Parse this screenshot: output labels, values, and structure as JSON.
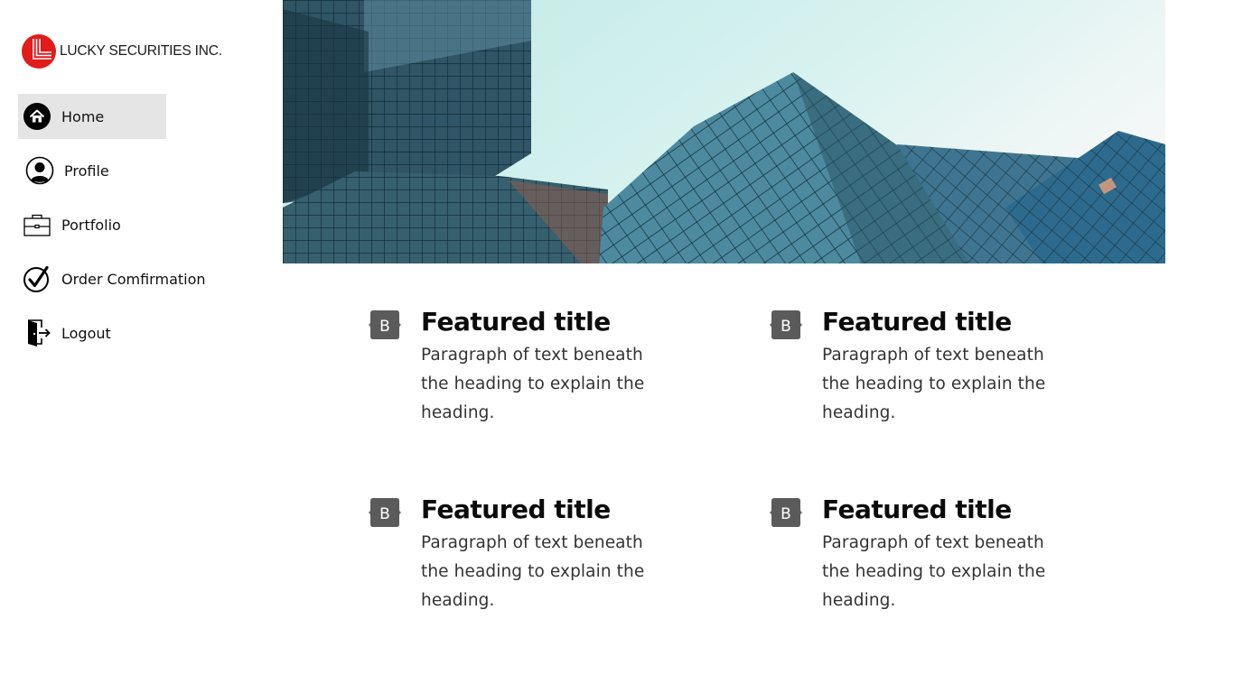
{
  "brand": {
    "name": "LUCKY SECURITIES INC.",
    "logo_color": "#e21b1b"
  },
  "sidebar": {
    "items": [
      {
        "label": "Home",
        "icon": "home-icon",
        "active": true
      },
      {
        "label": "Profile",
        "icon": "user-icon",
        "active": false
      },
      {
        "label": "Portfolio",
        "icon": "briefcase-icon",
        "active": false
      },
      {
        "label": "Order Comfirmation",
        "icon": "check-circle-icon",
        "active": false
      },
      {
        "label": "Logout",
        "icon": "logout-icon",
        "active": false
      }
    ]
  },
  "hero": {
    "image": "glass-skyscrapers-photo"
  },
  "features": [
    {
      "icon": "bootstrap-icon",
      "title": "Featured title",
      "text": "Paragraph of text beneath the heading to explain the heading."
    },
    {
      "icon": "bootstrap-icon",
      "title": "Featured title",
      "text": "Paragraph of text beneath the heading to explain the heading."
    },
    {
      "icon": "bootstrap-icon",
      "title": "Featured title",
      "text": "Paragraph of text beneath the heading to explain the heading."
    },
    {
      "icon": "bootstrap-icon",
      "title": "Featured title",
      "text": "Paragraph of text beneath the heading to explain the heading."
    }
  ],
  "colors": {
    "active_bg": "#e5e5e5",
    "badge": "#5b5b5b",
    "sky": "#c8ecea"
  }
}
